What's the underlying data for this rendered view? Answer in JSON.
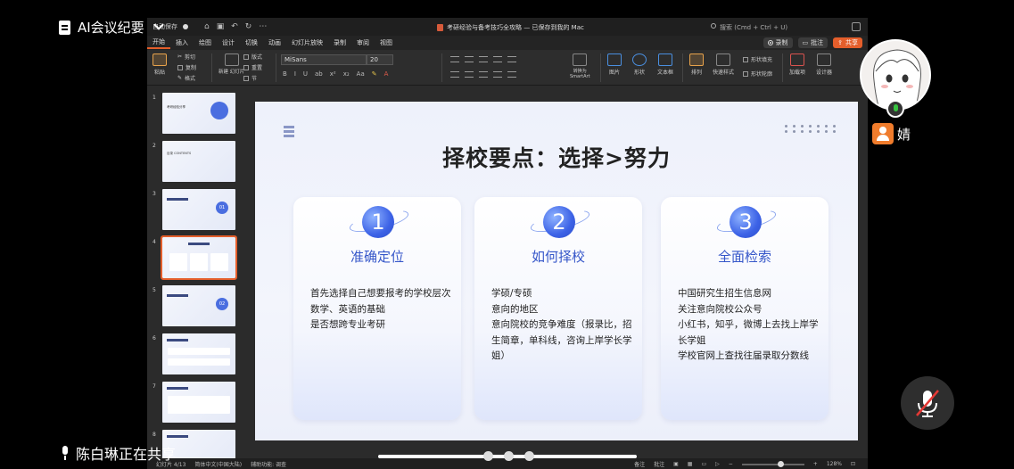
{
  "meeting": {
    "title": "AI会议纪要",
    "sharing_text": "陈白琳正在共享",
    "participant_name": "婧"
  },
  "app": {
    "autosave": "自动保存",
    "doc_title": "考研经验与备考技巧全攻略 — 已保存到我的 Mac",
    "search": "搜索 (Cmd + Ctrl + U)"
  },
  "menu": [
    "开始",
    "插入",
    "绘图",
    "设计",
    "切换",
    "动画",
    "幻灯片放映",
    "录制",
    "审阅",
    "视图"
  ],
  "menu_right": {
    "record": "录制",
    "comment": "批注",
    "share": "共享"
  },
  "ribbon": {
    "paste": "粘贴",
    "cut": "剪切",
    "copy": "复制",
    "format": "格式",
    "new_slide": "新建\n幻灯片",
    "layout": "版式",
    "reset": "重置",
    "section": "节",
    "font": "MiSans",
    "size": "20",
    "smartart": "转换为\nSmartArt",
    "picture": "图片",
    "shape": "形状",
    "textbox": "文本框",
    "arrange": "排列",
    "quick_style": "快速样式",
    "shape_fill": "形状填充",
    "shape_outline": "形状轮廓",
    "addins": "加载项",
    "designer": "设计器"
  },
  "thumbnails": [
    {
      "num": "1",
      "label": "考研经验分享"
    },
    {
      "num": "2",
      "label": "目录 CONTENTS"
    },
    {
      "num": "3",
      "label": "01"
    },
    {
      "num": "4",
      "label": ""
    },
    {
      "num": "5",
      "label": "02"
    },
    {
      "num": "6",
      "label": ""
    },
    {
      "num": "7",
      "label": ""
    },
    {
      "num": "8",
      "label": ""
    }
  ],
  "slide": {
    "title": "择校要点：选择>努力",
    "cards": [
      {
        "num": "1",
        "title": "准确定位",
        "lines": [
          "首先选择自己想要报考的学校层次",
          "数学、英语的基础",
          "是否想跨专业考研"
        ]
      },
      {
        "num": "2",
        "title": "如何择校",
        "lines": [
          "学硕/专硕",
          "意向的地区",
          "意向院校的竞争难度（报录比，招生简章，单科线，咨询上岸学长学姐）"
        ]
      },
      {
        "num": "3",
        "title": "全面检索",
        "lines": [
          "中国研究生招生信息网",
          "关注意向院校公众号",
          "小红书，知乎，微博上去找上岸学长学姐",
          "学校官网上查找往届录取分数线"
        ]
      }
    ]
  },
  "status": {
    "slide_info": "幻灯片 4/13",
    "language": "简体中文(中国大陆)",
    "accessibility": "辅助功能: 调查",
    "notes": "备注",
    "comments": "批注",
    "zoom": "128%"
  }
}
